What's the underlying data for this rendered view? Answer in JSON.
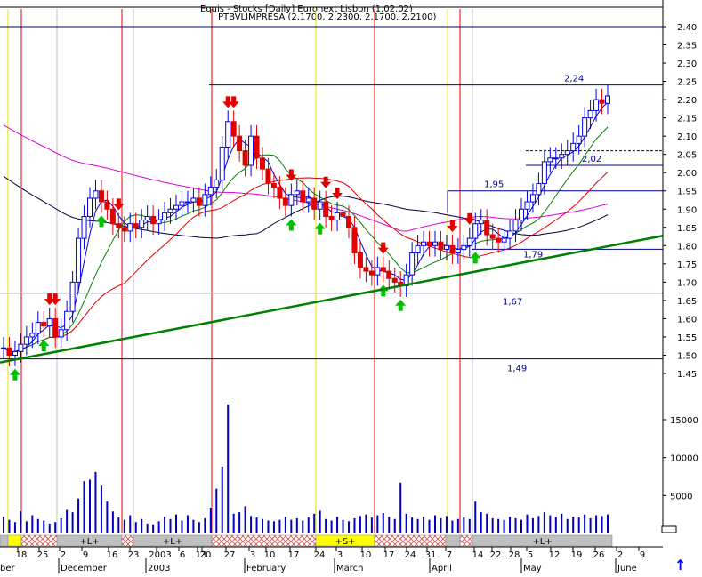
{
  "header": {
    "line1": "Equis - Stocks [Daily] Euronext Lisbon (1,02,02)",
    "line2": "PTBVLIMPRESA (2,1700, 2,2300, 2,1700, 2,2100)"
  },
  "chart_data": {
    "type": "candlestick",
    "symbol": "PTBVLIMPRESA",
    "last_ohlc": [
      2.17,
      2.23,
      2.17,
      2.21
    ],
    "price_axis": {
      "ylim": [
        1.45,
        2.4
      ],
      "ticks": [
        "2.40",
        "2.35",
        "2.30",
        "2.25",
        "2.20",
        "2.15",
        "2.10",
        "2.05",
        "2.00",
        "1.95",
        "1.90",
        "1.85",
        "1.80",
        "1.75",
        "1.70",
        "1.65",
        "1.60",
        "1.55",
        "1.50",
        "1.45"
      ]
    },
    "volume_axis": {
      "ylim": [
        0,
        20000
      ],
      "ticks": [
        "15000",
        "10000",
        "5000"
      ]
    },
    "x_ticks": [
      "18",
      "25",
      "2",
      "9",
      "16",
      "23",
      "2003",
      "6",
      "13",
      "20",
      "27",
      "3",
      "10",
      "17",
      "24",
      "3",
      "10",
      "17",
      "24",
      "31",
      "7",
      "14",
      "22",
      "28",
      "5",
      "12",
      "19",
      "26",
      "2",
      "9"
    ],
    "month_labels": [
      "ber",
      "December",
      "2003",
      "February",
      "March",
      "April",
      "May",
      "June"
    ],
    "price_levels": [
      {
        "label": "2,24",
        "value": 2.24
      },
      {
        "label": "2,02",
        "value": 2.02
      },
      {
        "label": "1,95",
        "value": 1.95
      },
      {
        "label": "1,79",
        "value": 1.79
      },
      {
        "label": "1,67",
        "value": 1.67
      },
      {
        "label": "1,49",
        "value": 1.49
      }
    ],
    "close_series": [
      1.52,
      1.5,
      1.51,
      1.53,
      1.55,
      1.56,
      1.59,
      1.58,
      1.6,
      1.55,
      1.57,
      1.62,
      1.7,
      1.82,
      1.88,
      1.93,
      1.95,
      1.92,
      1.9,
      1.86,
      1.85,
      1.84,
      1.86,
      1.85,
      1.87,
      1.88,
      1.86,
      1.87,
      1.89,
      1.9,
      1.91,
      1.92,
      1.92,
      1.93,
      1.91,
      1.94,
      1.96,
      1.98,
      2.07,
      2.14,
      2.1,
      2.06,
      2.02,
      2.1,
      2.04,
      2.01,
      1.97,
      1.96,
      1.93,
      1.91,
      1.94,
      1.95,
      1.92,
      1.93,
      1.9,
      1.92,
      1.88,
      1.87,
      1.89,
      1.88,
      1.85,
      1.78,
      1.74,
      1.73,
      1.72,
      1.74,
      1.73,
      1.71,
      1.7,
      1.69,
      1.72,
      1.78,
      1.8,
      1.81,
      1.8,
      1.81,
      1.79,
      1.8,
      1.78,
      1.79,
      1.8,
      1.82,
      1.86,
      1.87,
      1.83,
      1.82,
      1.81,
      1.82,
      1.84,
      1.87,
      1.9,
      1.92,
      1.94,
      1.97,
      2.03,
      2.04,
      2.04,
      2.05,
      2.06,
      2.08,
      2.1,
      2.15,
      2.17,
      2.2,
      2.19,
      2.21
    ],
    "volume_series": [
      2200,
      1800,
      1500,
      2900,
      1600,
      2400,
      1900,
      1700,
      1300,
      1500,
      2000,
      3100,
      2800,
      4600,
      6900,
      7100,
      8100,
      6300,
      4200,
      2900,
      2100,
      1800,
      2400,
      1500,
      1900,
      1300,
      1200,
      1600,
      2200,
      1900,
      2500,
      1700,
      2400,
      1800,
      1500,
      2000,
      3400,
      5900,
      8800,
      17000,
      2600,
      2800,
      3600,
      2300,
      2100,
      1900,
      1700,
      1600,
      1800,
      2200,
      1800,
      2000,
      1700,
      2100,
      2600,
      3000,
      1900,
      1700,
      2200,
      1800,
      1600,
      2000,
      2300,
      2500,
      2100,
      2400,
      2700,
      2200,
      1900,
      6700,
      2600,
      2100,
      1900,
      2200,
      1800,
      2400,
      2000,
      2300,
      1700,
      1900,
      2100,
      1900,
      4200,
      2800,
      2600,
      2000,
      1900,
      1800,
      2200,
      2000,
      1800,
      2500,
      2000,
      2300,
      2800,
      2400,
      2200,
      2600,
      1900,
      2200,
      2100,
      2500,
      2000,
      2400,
      2300,
      2500
    ],
    "signal_bar": [
      "+L+",
      "+L+",
      "+S+",
      "+L+"
    ]
  },
  "scroll_up_label": "↑"
}
